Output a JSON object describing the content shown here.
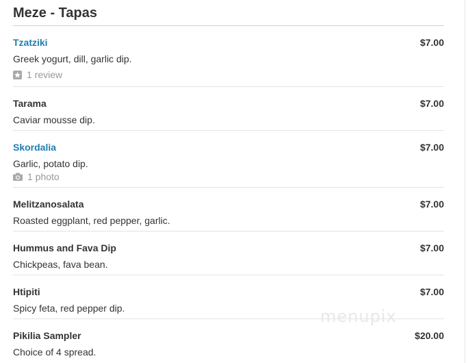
{
  "section": {
    "title": "Meze - Tapas"
  },
  "items": [
    {
      "name": "Tzatziki",
      "price": "$7.00",
      "description": "Greek yogurt, dill, garlic dip.",
      "extra": {
        "icon": "star-review-icon",
        "text": "1 review"
      }
    },
    {
      "name": "Tarama",
      "price": "$7.00",
      "description": "Caviar mousse dip."
    },
    {
      "name": "Skordalia",
      "price": "$7.00",
      "description": "Garlic, potato dip.",
      "extra": {
        "icon": "camera-icon",
        "text": "1 photo"
      }
    },
    {
      "name": "Melitzanosalata",
      "price": "$7.00",
      "description": "Roasted eggplant, red pepper, garlic."
    },
    {
      "name": "Hummus and Fava Dip",
      "price": "$7.00",
      "description": "Chickpeas, fava bean."
    },
    {
      "name": "Htipiti",
      "price": "$7.00",
      "description": "Spicy feta, red pepper dip."
    },
    {
      "name": "Pikilia Sampler",
      "price": "$20.00",
      "description": "Choice of 4 spread."
    }
  ],
  "watermark": "menupix",
  "colors": {
    "link": "#1f7db0",
    "text": "#333333",
    "muted": "#999999",
    "divider": "#e3e3e3"
  }
}
